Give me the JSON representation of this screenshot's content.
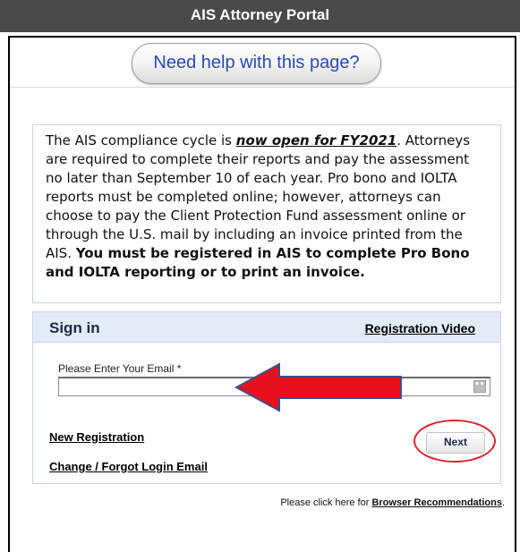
{
  "portal": {
    "title": "AIS Attorney Portal"
  },
  "help": {
    "label": "Need help with this page?"
  },
  "notice": {
    "text_1": "The AIS compliance cycle is ",
    "highlight": "now open for FY2021",
    "text_2": ". Attorneys are required to complete their reports and pay the assessment no later than September 10 of each year. Pro bono and IOLTA reports must be completed online; however, attorneys can choose to pay the Client Protection Fund assessment online or through the U.S. mail by including an invoice printed from the AIS. ",
    "bold": "You must be registered in AIS to complete Pro Bono and IOLTA reporting or to print an invoice."
  },
  "signin": {
    "title": "Sign in",
    "registration_video": "Registration Video",
    "email_label": "Please Enter Your Email *",
    "email_value": "",
    "new_registration": "New Registration",
    "change_email": "Change / Forgot Login Email",
    "next": "Next"
  },
  "footer": {
    "prefix": "Please click here for ",
    "link": "Browser Recommendations",
    "suffix": "."
  },
  "annotations": {
    "arrow_color": "#e8101c",
    "arrow_outline": "#3b4f8c",
    "circle_color": "#d9232d"
  },
  "icons": {
    "field_button": "ellipsis-icon",
    "annotation_arrow": "red-arrow-icon",
    "annotation_circle": "red-circle-icon"
  }
}
